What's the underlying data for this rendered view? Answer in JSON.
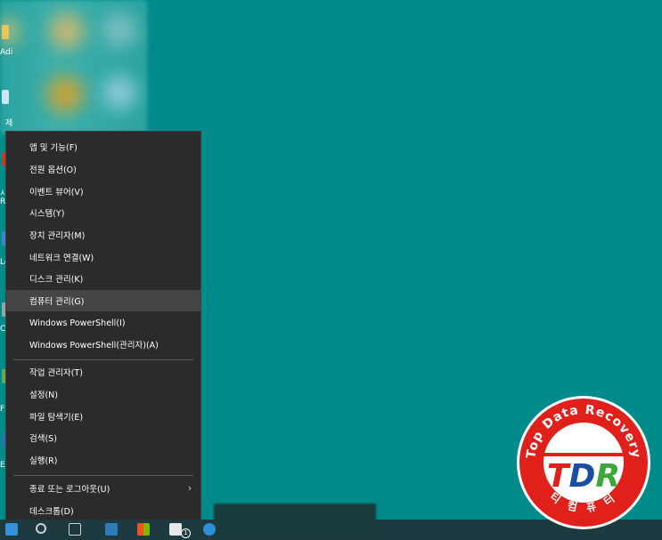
{
  "desktop": {
    "background_color": "#008b8b",
    "icon_labels": [
      "Adi",
      "제",
      "시",
      "Re",
      "Lo",
      "C",
      "F",
      "Ep"
    ]
  },
  "context_menu": {
    "group1": [
      {
        "label": "앱 및 기능(F)"
      },
      {
        "label": "전원 옵션(O)"
      },
      {
        "label": "이벤트 뷰어(V)"
      },
      {
        "label": "시스템(Y)"
      },
      {
        "label": "장치 관리자(M)"
      },
      {
        "label": "네트워크 연결(W)"
      },
      {
        "label": "디스크 관리(K)"
      },
      {
        "label": "컴퓨터 관리(G)",
        "highlighted": true
      },
      {
        "label": "Windows PowerShell(I)"
      },
      {
        "label": "Windows PowerShell(관리자)(A)"
      }
    ],
    "group2": [
      {
        "label": "작업 관리자(T)"
      },
      {
        "label": "설정(N)"
      },
      {
        "label": "파일 탐색기(E)"
      },
      {
        "label": "검색(S)"
      },
      {
        "label": "실행(R)"
      }
    ],
    "group3": [
      {
        "label": "종료 또는 로그아웃(U)",
        "has_submenu": true
      },
      {
        "label": "데스크톱(D)"
      }
    ]
  },
  "taskbar": {
    "badge": "1"
  },
  "logo": {
    "ring_text": "Top Data Recovery",
    "letters": "TDR",
    "bottom_text": "티 컴 퓨 터"
  }
}
